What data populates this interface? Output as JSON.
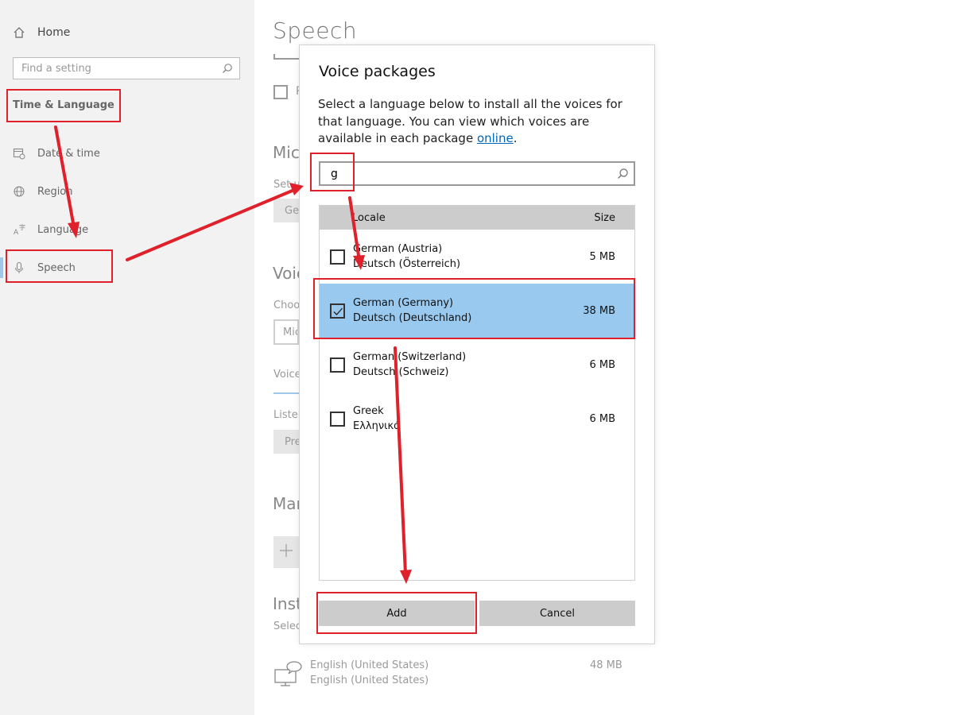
{
  "sidebar": {
    "home_label": "Home",
    "search_placeholder": "Find a setting",
    "section_title": "Time & Language",
    "items": [
      {
        "label": "Date & time",
        "icon": "calendar-clock-icon"
      },
      {
        "label": "Region",
        "icon": "globe-icon"
      },
      {
        "label": "Language",
        "icon": "language-icon"
      },
      {
        "label": "Speech",
        "icon": "microphone-icon"
      }
    ]
  },
  "main": {
    "page_title": "Speech",
    "partial": {
      "check_label": "R",
      "mic_heading": "Micr",
      "mic_text": "Set u",
      "mic_button": "Get",
      "voice_heading": "Voic",
      "choose_text": "Choo",
      "voice_select": "Micr",
      "voice_tab": "Voice",
      "listen_text": "Listen",
      "preview_button": "Pre",
      "manage_heading": "Man",
      "installed_heading": "Insta",
      "select_text": "Select"
    },
    "installed_item": {
      "name": "English (United States)",
      "native": "English (United States)",
      "size": "48 MB"
    }
  },
  "dialog": {
    "title": "Voice packages",
    "description_prefix": "Select a language below to install all the voices for that language. You can view which voices are available in each package ",
    "description_link": "online",
    "description_suffix": ".",
    "search_value": "g",
    "columns": {
      "locale": "Locale",
      "size": "Size"
    },
    "rows": [
      {
        "name": "German (Austria)",
        "native": "Deutsch (Österreich)",
        "size": "5 MB",
        "checked": false
      },
      {
        "name": "German (Germany)",
        "native": "Deutsch (Deutschland)",
        "size": "38 MB",
        "checked": true
      },
      {
        "name": "German (Switzerland)",
        "native": "Deutsch (Schweiz)",
        "size": "6 MB",
        "checked": false
      },
      {
        "name": "Greek",
        "native": "Ελληνικά",
        "size": "6 MB",
        "checked": false
      }
    ],
    "add_label": "Add",
    "cancel_label": "Cancel"
  },
  "colors": {
    "annotation": "#e0202a",
    "selected_row": "#99c9ee",
    "link": "#0067b8"
  }
}
